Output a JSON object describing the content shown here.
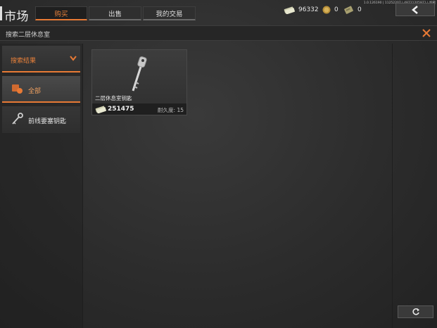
{
  "version": "1.0.126190 | 11252207 | 48721205971 | 加载",
  "title": "市场",
  "tabs": [
    {
      "label": "购买",
      "active": true
    },
    {
      "label": "出售",
      "active": false
    },
    {
      "label": "我的交易",
      "active": false
    }
  ],
  "currencies": [
    {
      "icon": "cash-icon",
      "value": "96332"
    },
    {
      "icon": "coin-icon",
      "value": "0"
    },
    {
      "icon": "ticket-icon",
      "value": "0"
    }
  ],
  "search": {
    "text": "搜索二层休息室"
  },
  "sidebar": {
    "header": "搜索结果",
    "items": [
      {
        "label": "全部",
        "icon": "all-items-icon",
        "active": true
      },
      {
        "label": "前线要塞钥匙",
        "icon": "key-icon",
        "active": false
      }
    ]
  },
  "listings": [
    {
      "name": "二层休息室钥匙",
      "price": "251475",
      "durability_label": "耐久度: 15"
    }
  ],
  "colors": {
    "accent": "#e87a35",
    "background": "#2b2b2b"
  }
}
